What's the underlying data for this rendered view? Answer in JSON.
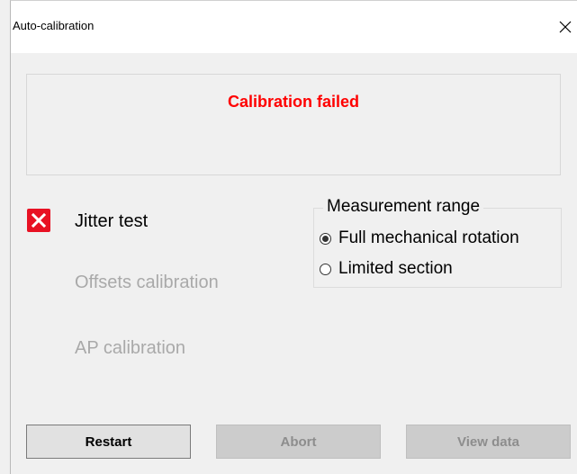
{
  "window": {
    "title": "Auto-calibration",
    "close_glyph": "✕"
  },
  "status": {
    "text": "Calibration failed",
    "color": "#ff0000"
  },
  "steps": [
    {
      "label": "Jitter test",
      "state": "failed",
      "icon": "fail-x-icon"
    },
    {
      "label": "Offsets calibration",
      "state": "disabled"
    },
    {
      "label": "AP calibration",
      "state": "disabled"
    }
  ],
  "measurement_range": {
    "title": "Measurement range",
    "options": [
      {
        "label": "Full mechanical rotation",
        "selected": true
      },
      {
        "label": "Limited section",
        "selected": false
      }
    ]
  },
  "buttons": {
    "restart": "Restart",
    "abort": "Abort",
    "view_data": "View data"
  },
  "colors": {
    "fail_icon": "#e81123",
    "disabled_text": "#a9a9a9"
  }
}
